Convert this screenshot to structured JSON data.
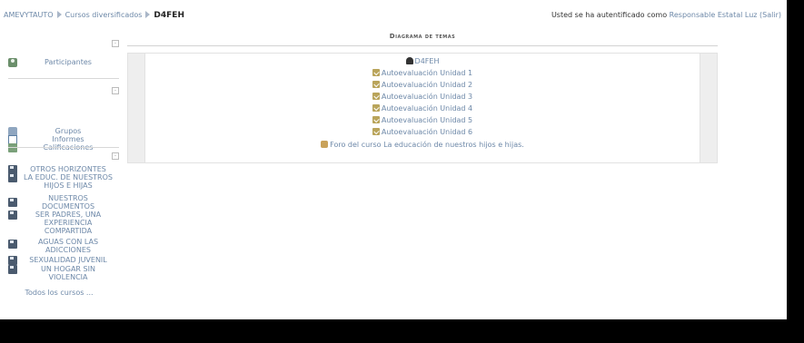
{
  "breadcrumb": {
    "home": "AMEVYTAUTO",
    "category": "Cursos diversificados",
    "current": "D4FEH"
  },
  "login": {
    "prefix": "Usted se ha autentificado como",
    "user": "Responsable Estatal Luz",
    "logout": "(Salir)"
  },
  "blocks": {
    "people": {
      "toggle": "-",
      "participants": "Participantes"
    },
    "admin": {
      "toggle": "-",
      "groups": "Grupos",
      "reports": "Informes",
      "grades": "Calificaciones"
    },
    "courses": {
      "toggle": "-",
      "items": [
        "OTROS HORIZONTES",
        "LA EDUC. DE NUESTROS HIJOS E HIJAS",
        "NUESTROS DOCUMENTOS",
        "SER PADRES, UNA EXPERIENCIA COMPARTIDA",
        "AGUAS CON LAS ADICCIONES",
        "SEXUALIDAD JUVENIL",
        "UN HOGAR SIN VIOLENCIA"
      ],
      "all_courses": "Todos los cursos ..."
    }
  },
  "main": {
    "section_title": "Diagrama de temas",
    "activities": [
      {
        "label": "D4FEH",
        "icon": "person-icon"
      },
      {
        "label": "Autoevaluación Unidad 1",
        "icon": "quiz-icon"
      },
      {
        "label": "Autoevaluación Unidad 2",
        "icon": "quiz-icon"
      },
      {
        "label": "Autoevaluación Unidad 3",
        "icon": "quiz-icon"
      },
      {
        "label": "Autoevaluación Unidad 4",
        "icon": "quiz-icon"
      },
      {
        "label": "Autoevaluación Unidad 5",
        "icon": "quiz-icon"
      },
      {
        "label": "Autoevaluación Unidad 6",
        "icon": "quiz-icon"
      },
      {
        "label": "Foro del curso La educación de nuestros hijos e hijas.",
        "icon": "forum-icon"
      }
    ]
  }
}
